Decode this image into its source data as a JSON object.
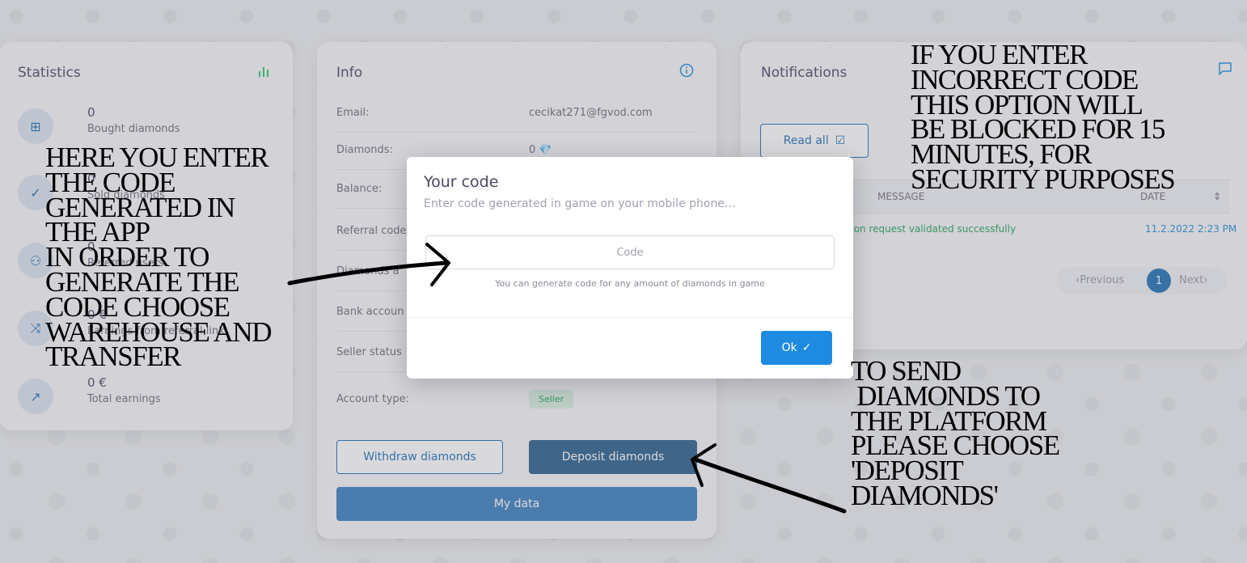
{
  "statistics": {
    "title": "Statistics",
    "icon": "bar-chart-icon",
    "items": [
      {
        "value": "0",
        "label": "Bought diamonds",
        "icon": "gift-icon"
      },
      {
        "value": "0",
        "label": "Sold diamonds",
        "icon": "check-icon"
      },
      {
        "value": "0",
        "label": "Referred users",
        "icon": "users-icon"
      },
      {
        "value": "0 €",
        "label": "Earnings from referral link",
        "icon": "shuffle-icon"
      },
      {
        "value": "0 €",
        "label": "Total earnings",
        "icon": "trending-up-icon"
      }
    ]
  },
  "info": {
    "title": "Info",
    "icon": "info-icon",
    "rows": [
      {
        "key": "Email:",
        "value": "cecikat271@fgvod.com"
      },
      {
        "key": "Diamonds:",
        "value": "0 💎"
      },
      {
        "key": "Balance:",
        "value": ""
      },
      {
        "key": "Referral code",
        "value": ""
      },
      {
        "key": "Diamonds a",
        "value": ""
      },
      {
        "key": "Bank accoun",
        "value": ""
      },
      {
        "key": "Seller status",
        "value": ""
      },
      {
        "key": "Account type:",
        "value": ""
      }
    ],
    "account_type_badge": "Seller",
    "withdraw_label": "Withdraw diamonds",
    "deposit_label": "Deposit diamonds",
    "my_data_label": "My data"
  },
  "notifications": {
    "title": "Notifications",
    "icon": "message-square-icon",
    "read_all_label": "Read all",
    "columns": [
      "MESSAGE",
      "DATE"
    ],
    "row": {
      "message": "Transaction request validated successfully",
      "date": "11.2.2022 2:23 PM"
    },
    "pager": {
      "prev": "Previous",
      "page": "1",
      "next": "Next"
    }
  },
  "modal": {
    "title": "Your code",
    "subtitle": "Enter code generated in game on your mobile phone...",
    "input_placeholder": "Code",
    "hint": "You can generate code for any amount of diamonds in game",
    "ok_label": "Ok"
  },
  "annotations": {
    "left": "HERE YOU ENTER\nTHE CODE\nGENERATED IN\nTHE APP\nIN ORDER TO\nGENERATE THE\nCODE CHOOSE\nWAREHOUSE AND\nTRANSFER",
    "top_right": "IF YOU ENTER\nINCORRECT CODE\nTHIS OPTION WILL\nBE BLOCKED FOR 15\nMINUTES, FOR\nSECURITY PURPOSES",
    "bottom_right": "TO SEND\n DIAMONDS TO\nTHE PLATFORM\nPLEASE CHOOSE\n'DEPOSIT\nDIAMONDS'"
  }
}
